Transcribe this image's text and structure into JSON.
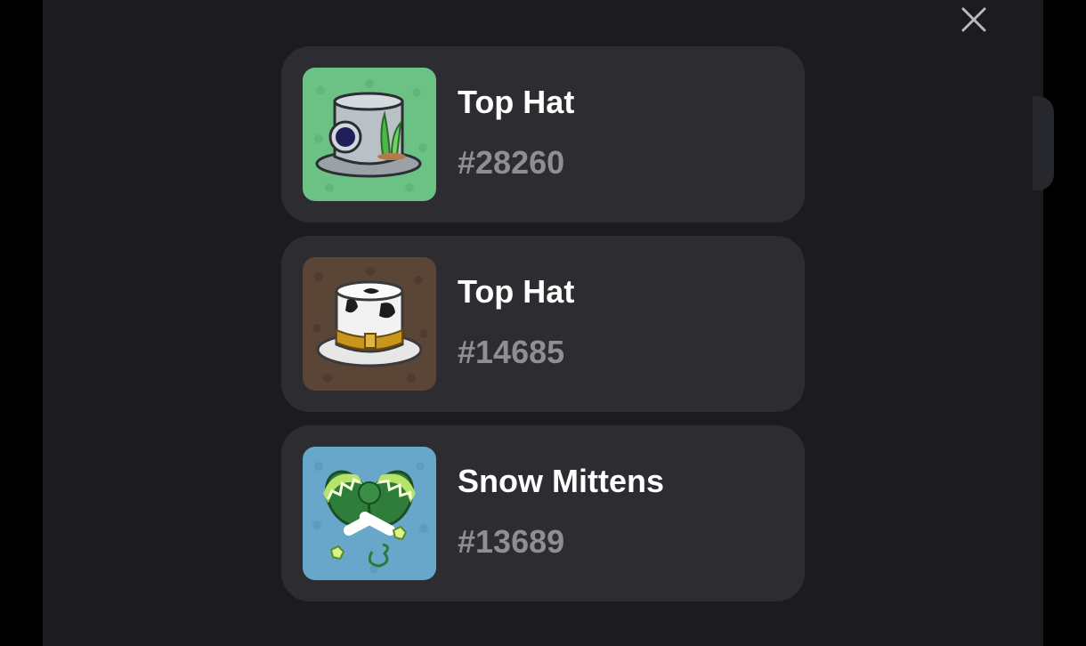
{
  "items": [
    {
      "name": "Top Hat",
      "number": "#28260",
      "icon": "steel-top-hat-icon",
      "thumb_bg": "#6cc185"
    },
    {
      "name": "Top Hat",
      "number": "#14685",
      "icon": "cow-print-top-hat-icon",
      "thumb_bg": "#5a4536"
    },
    {
      "name": "Snow Mittens",
      "number": "#13689",
      "icon": "snow-mittens-icon",
      "thumb_bg": "#68a7c9"
    }
  ],
  "close_icon": "close-icon"
}
